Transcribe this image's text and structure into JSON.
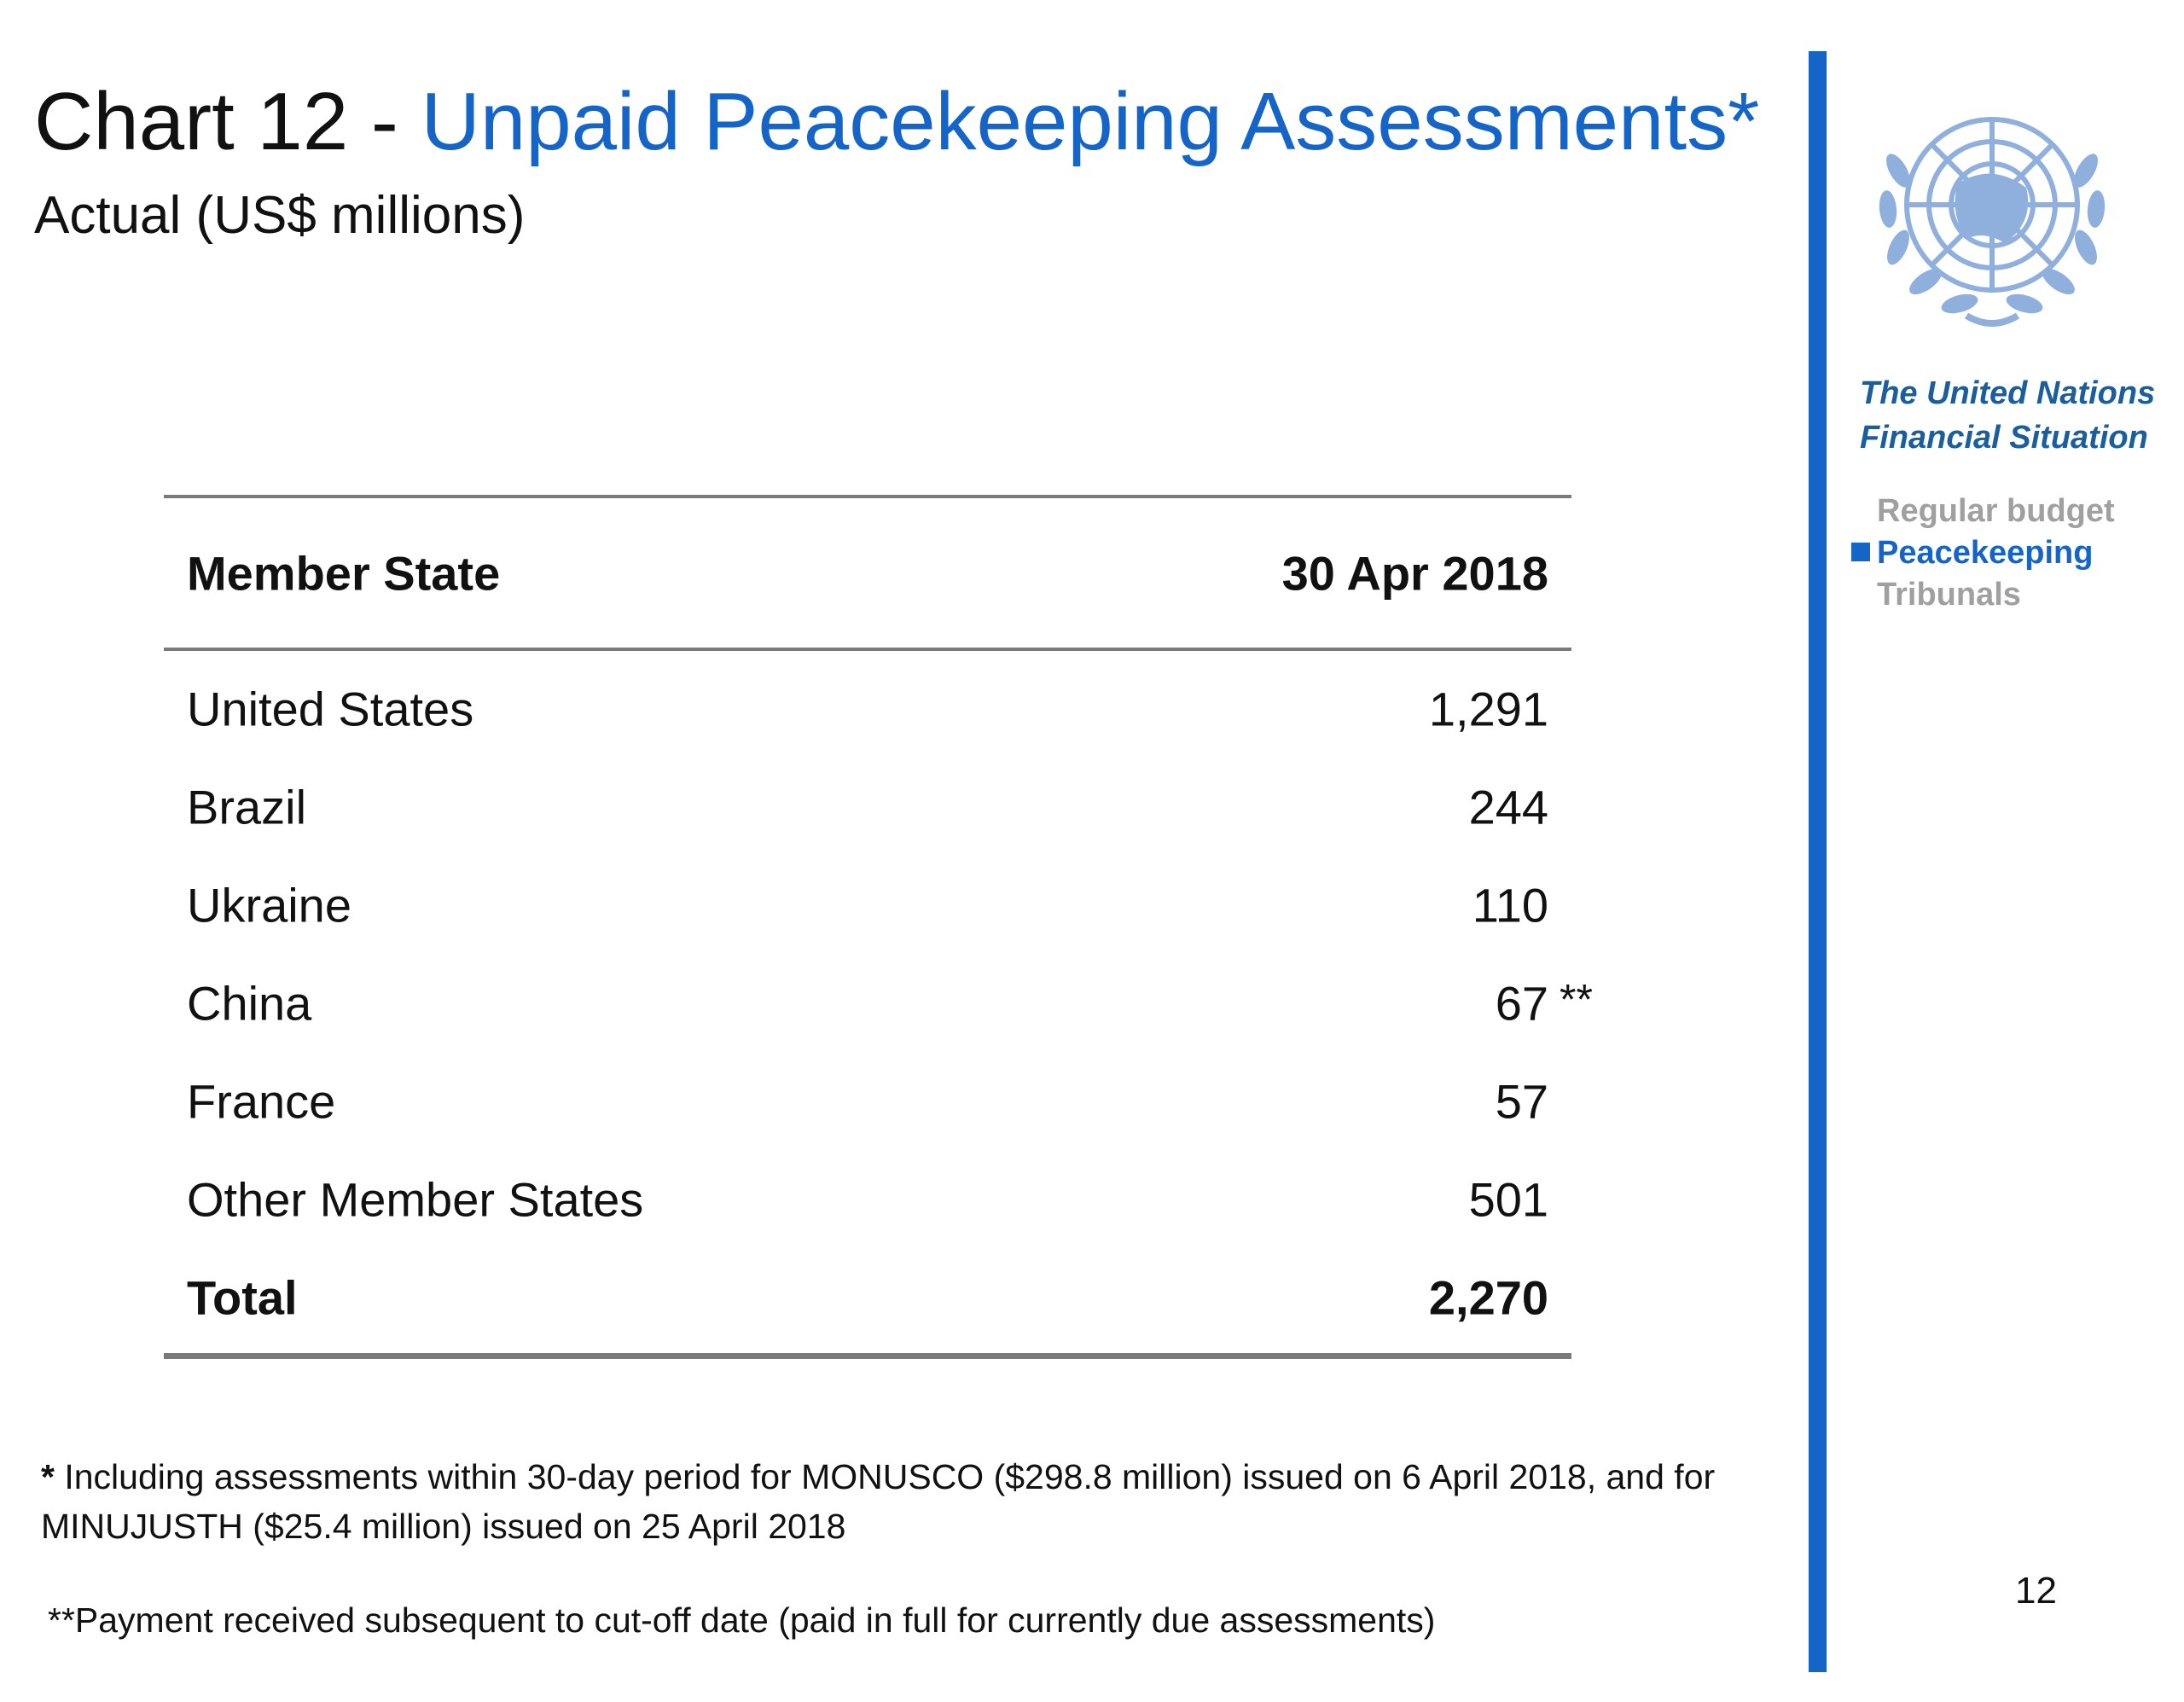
{
  "slide": {
    "title_prefix": "Chart 12 - ",
    "title_main": "Unpaid Peacekeeping Assessments*",
    "subtitle": "Actual (US$ millions)",
    "page_number": "12"
  },
  "table": {
    "headers": [
      "Member State",
      "30 Apr 2018"
    ],
    "rows": [
      {
        "name": "United States",
        "value": "1,291",
        "note": ""
      },
      {
        "name": "Brazil",
        "value": "244",
        "note": ""
      },
      {
        "name": "Ukraine",
        "value": "110",
        "note": ""
      },
      {
        "name": "China",
        "value": "67",
        "note": "**"
      },
      {
        "name": "France",
        "value": "57",
        "note": ""
      },
      {
        "name": "Other Member States",
        "value": "501",
        "note": ""
      }
    ],
    "total": {
      "name": "Total",
      "value": "2,270"
    }
  },
  "footnotes": {
    "note1_mark": "*",
    "note1_text": " Including assessments within 30-day period for MONUSCO ($298.8 million) issued on 6 April 2018, and for MINUJUSTH ($25.4 million) issued on 25 April 2018",
    "note2": "**Payment received subsequent to cut-off date (paid in full for currently due assessments)"
  },
  "sidebar": {
    "title_line1": "The United Nations",
    "title_line2": "Financial Situation",
    "nav": [
      {
        "label": "Regular budget",
        "active": false
      },
      {
        "label": "Peacekeeping",
        "active": true
      },
      {
        "label": "Tribunals",
        "active": false
      }
    ],
    "logo_icon": "un-emblem-icon"
  },
  "colors": {
    "accent": "#1565c8",
    "sidebar_title": "#1a5e9e",
    "inactive_nav": "#a0a0a0",
    "rule": "#7a7a7a"
  }
}
